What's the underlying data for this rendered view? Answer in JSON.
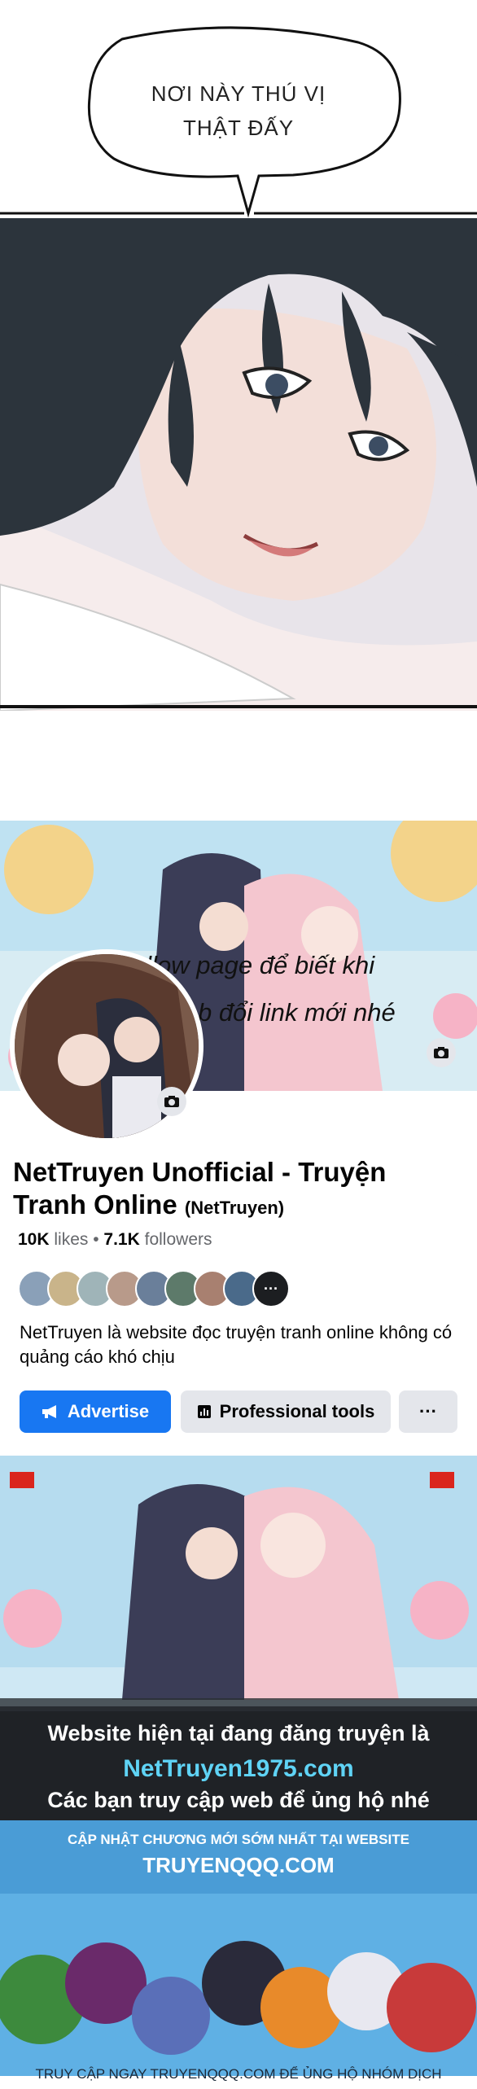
{
  "speech_bubble": {
    "line1": "NƠI NÀY THÚ VỊ",
    "line2": "THẬT ĐẤY"
  },
  "fb_card": {
    "follow_line1": "Follow page để biết khi",
    "follow_line2": "nào web đổi link mới nhé",
    "page_name": "NetTruyen Unofficial - Truyện Tranh Online",
    "handle": "(NetTruyen)",
    "likes_count": "10K",
    "likes_label": "likes",
    "followers_count": "7.1K",
    "followers_label": "followers",
    "description": "NetTruyen là website đọc truyện tranh online không có quảng cáo khó chịu",
    "advertise_label": "Advertise",
    "professional_tools_label": "Professional tools",
    "more_label": "···",
    "friends_more_label": "···"
  },
  "promo": {
    "line1": "Website hiện tại đang đăng truyện là",
    "site": "NetTruyen1975.com",
    "line3": "Các bạn truy cập web để ủng hộ nhé"
  },
  "banner2": {
    "headline": "CẬP NHẬT CHƯƠNG MỚI SỚM NHẤT TẠI WEBSITE",
    "site": "TRUYENQQQ.COM",
    "footer": "TRUY CẬP NGAY TRUYENQQQ.COM ĐỂ ỦNG HỘ NHÓM DỊCH"
  },
  "colors": {
    "fb_blue": "#1877f2",
    "fb_gray_btn": "#e4e6eb",
    "promo_cyan": "#5fd3f5"
  }
}
